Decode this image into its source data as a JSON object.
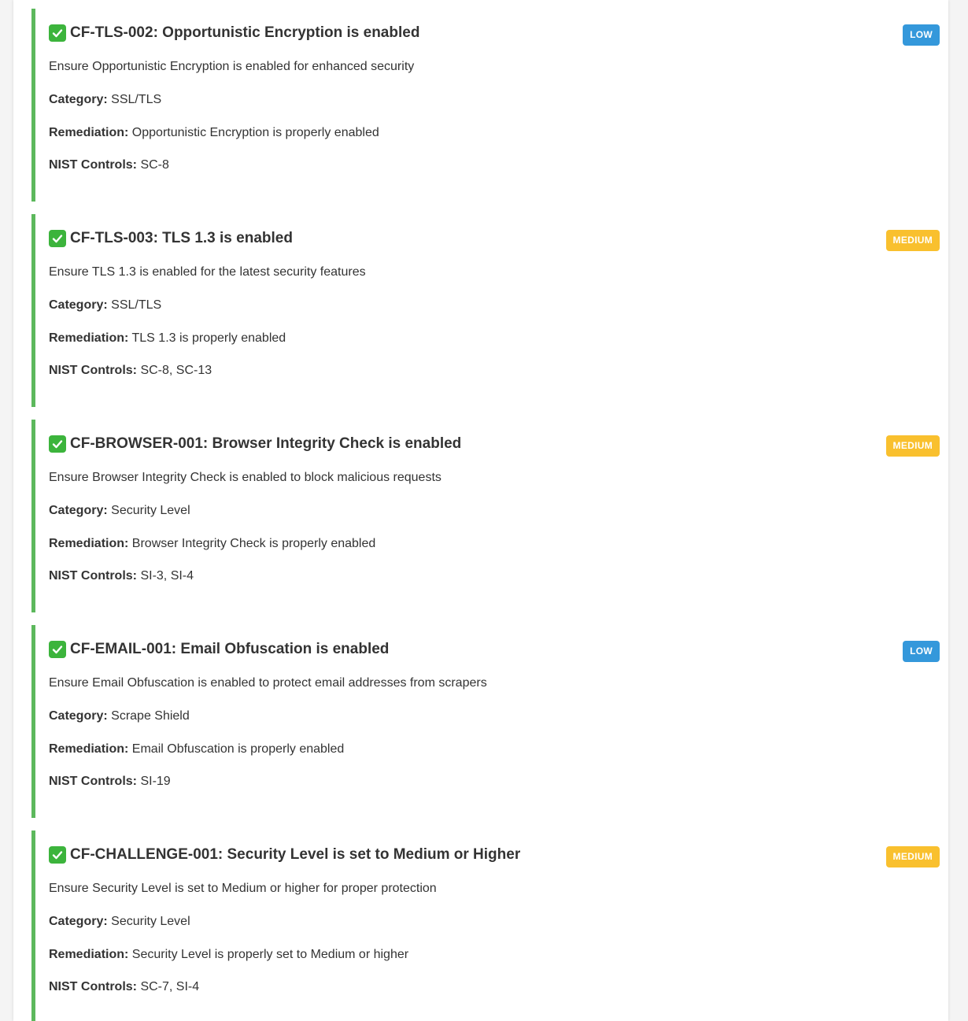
{
  "labels": {
    "category": "Category:",
    "remediation": "Remediation:",
    "nist": "NIST Controls:"
  },
  "colors": {
    "pass_border": "#5cb85c",
    "check_icon": "#3cb43c",
    "low_badge": "#3498db",
    "medium_badge": "#f9c02e"
  },
  "checks": [
    {
      "icon": "check-mark-icon",
      "title": "CF-TLS-002: Opportunistic Encryption is enabled",
      "severity": "LOW",
      "description": "Ensure Opportunistic Encryption is enabled for enhanced security",
      "category": "SSL/TLS",
      "remediation": "Opportunistic Encryption is properly enabled",
      "nist": "SC-8"
    },
    {
      "icon": "check-mark-icon",
      "title": "CF-TLS-003: TLS 1.3 is enabled",
      "severity": "MEDIUM",
      "description": "Ensure TLS 1.3 is enabled for the latest security features",
      "category": "SSL/TLS",
      "remediation": "TLS 1.3 is properly enabled",
      "nist": "SC-8, SC-13"
    },
    {
      "icon": "check-mark-icon",
      "title": "CF-BROWSER-001: Browser Integrity Check is enabled",
      "severity": "MEDIUM",
      "description": "Ensure Browser Integrity Check is enabled to block malicious requests",
      "category": "Security Level",
      "remediation": "Browser Integrity Check is properly enabled",
      "nist": "SI-3, SI-4"
    },
    {
      "icon": "check-mark-icon",
      "title": "CF-EMAIL-001: Email Obfuscation is enabled",
      "severity": "LOW",
      "description": "Ensure Email Obfuscation is enabled to protect email addresses from scrapers",
      "category": "Scrape Shield",
      "remediation": "Email Obfuscation is properly enabled",
      "nist": "SI-19"
    },
    {
      "icon": "check-mark-icon",
      "title": "CF-CHALLENGE-001: Security Level is set to Medium or Higher",
      "severity": "MEDIUM",
      "description": "Ensure Security Level is set to Medium or higher for proper protection",
      "category": "Security Level",
      "remediation": "Security Level is properly set to Medium or higher",
      "nist": "SC-7, SI-4"
    }
  ]
}
